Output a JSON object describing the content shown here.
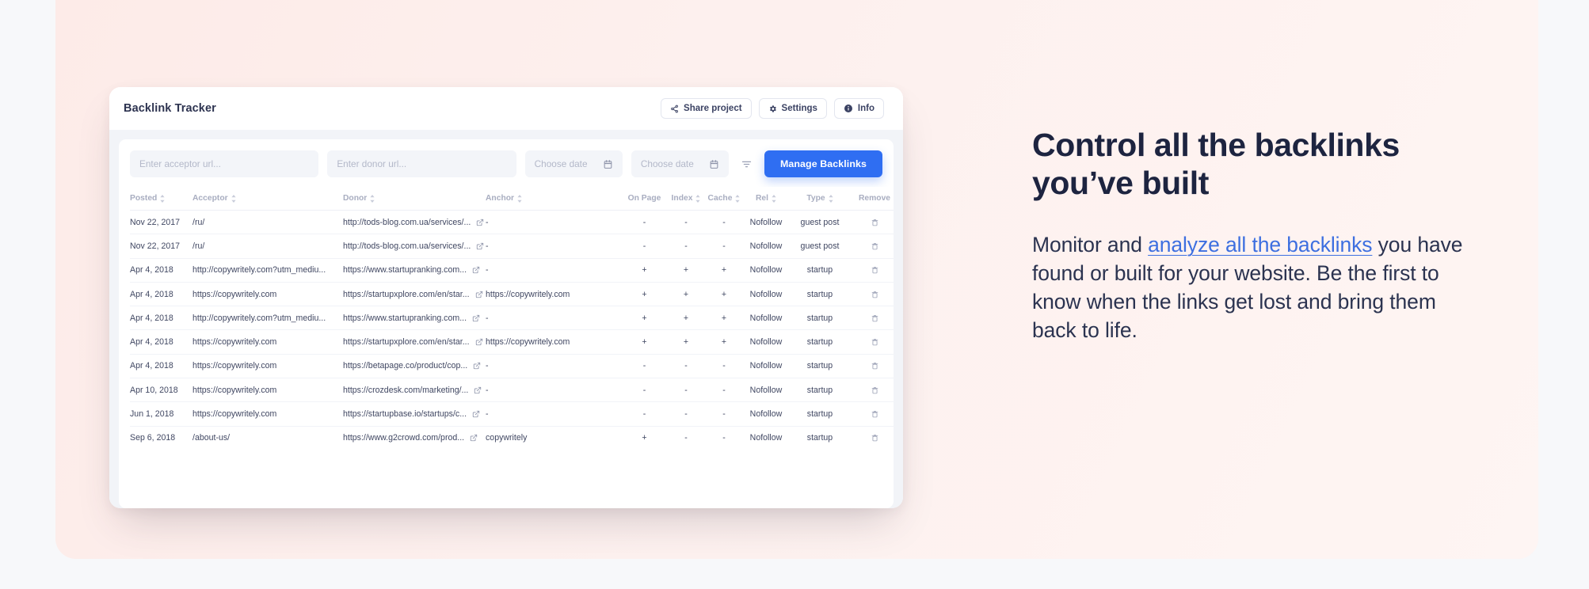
{
  "card": {
    "title": "Backlink Tracker",
    "actions": [
      {
        "label": "Share project",
        "icon": "share-icon"
      },
      {
        "label": "Settings",
        "icon": "gear-icon"
      },
      {
        "label": "Info",
        "icon": "info-icon"
      }
    ]
  },
  "filters": {
    "acceptor_placeholder": "Enter acceptor url...",
    "acceptor_value": "",
    "donor_placeholder": "Enter donor url...",
    "donor_value": "",
    "date_from_placeholder": "Choose date",
    "date_to_placeholder": "Choose date",
    "filter_icon": "filter-icon",
    "calendar_icon": "calendar-icon",
    "manage_button": "Manage Backlinks"
  },
  "table": {
    "columns": [
      {
        "label": "Posted",
        "sortable": true
      },
      {
        "label": "Acceptor",
        "sortable": true
      },
      {
        "label": "Donor",
        "sortable": true
      },
      {
        "label": "Anchor",
        "sortable": true
      },
      {
        "label": "On Page",
        "sortable": false
      },
      {
        "label": "Index",
        "sortable": true
      },
      {
        "label": "Cache",
        "sortable": true
      },
      {
        "label": "Rel",
        "sortable": true
      },
      {
        "label": "Type",
        "sortable": true
      },
      {
        "label": "Remove",
        "sortable": false
      }
    ],
    "rows": [
      {
        "posted": "Nov 22, 2017",
        "acceptor": "/ru/",
        "donor": "http://tods-blog.com.ua/services/...",
        "anchor": "-",
        "on_page": "-",
        "index": "-",
        "cache": "-",
        "rel": "Nofollow",
        "type": "guest post"
      },
      {
        "posted": "Nov 22, 2017",
        "acceptor": "/ru/",
        "donor": "http://tods-blog.com.ua/services/...",
        "anchor": "-",
        "on_page": "-",
        "index": "-",
        "cache": "-",
        "rel": "Nofollow",
        "type": "guest post"
      },
      {
        "posted": "Apr 4, 2018",
        "acceptor": "http://copywritely.com?utm_mediu...",
        "donor": "https://www.startupranking.com...",
        "anchor": "-",
        "on_page": "+",
        "index": "+",
        "cache": "+",
        "rel": "Nofollow",
        "type": "startup"
      },
      {
        "posted": "Apr 4, 2018",
        "acceptor": "https://copywritely.com",
        "donor": "https://startupxplore.com/en/star...",
        "anchor": "https://copywritely.com",
        "on_page": "+",
        "index": "+",
        "cache": "+",
        "rel": "Nofollow",
        "type": "startup"
      },
      {
        "posted": "Apr 4, 2018",
        "acceptor": "http://copywritely.com?utm_mediu...",
        "donor": "https://www.startupranking.com...",
        "anchor": "-",
        "on_page": "+",
        "index": "+",
        "cache": "+",
        "rel": "Nofollow",
        "type": "startup"
      },
      {
        "posted": "Apr 4, 2018",
        "acceptor": "https://copywritely.com",
        "donor": "https://startupxplore.com/en/star...",
        "anchor": "https://copywritely.com",
        "on_page": "+",
        "index": "+",
        "cache": "+",
        "rel": "Nofollow",
        "type": "startup"
      },
      {
        "posted": "Apr 4, 2018",
        "acceptor": "https://copywritely.com",
        "donor": "https://betapage.co/product/cop...",
        "anchor": "-",
        "on_page": "-",
        "index": "-",
        "cache": "-",
        "rel": "Nofollow",
        "type": "startup"
      },
      {
        "posted": "Apr 10, 2018",
        "acceptor": "https://copywritely.com",
        "donor": "https://crozdesk.com/marketing/...",
        "anchor": "-",
        "on_page": "-",
        "index": "-",
        "cache": "-",
        "rel": "Nofollow",
        "type": "startup"
      },
      {
        "posted": "Jun 1, 2018",
        "acceptor": "https://copywritely.com",
        "donor": "https://startupbase.io/startups/c...",
        "anchor": "-",
        "on_page": "-",
        "index": "-",
        "cache": "-",
        "rel": "Nofollow",
        "type": "startup"
      },
      {
        "posted": "Sep 6, 2018",
        "acceptor": "/about-us/",
        "donor": "https://www.g2crowd.com/prod...",
        "anchor": "copywritely",
        "on_page": "+",
        "index": "-",
        "cache": "-",
        "rel": "Nofollow",
        "type": "startup"
      }
    ]
  },
  "copy": {
    "heading_line1": "Control all the backlinks",
    "heading_line2": "you’ve built",
    "body_before": "Monitor and ",
    "body_link": "analyze all the backlinks",
    "body_after": " you have found or built for your website. Be the first to know when the links get lost and bring them back to life."
  },
  "colors": {
    "stage_pink": "#fdf0ee",
    "accent_blue": "#2f6ef2",
    "link_blue": "#3d6fe0",
    "heading_navy": "#1d2440",
    "page_bg": "#f7f8fa"
  }
}
